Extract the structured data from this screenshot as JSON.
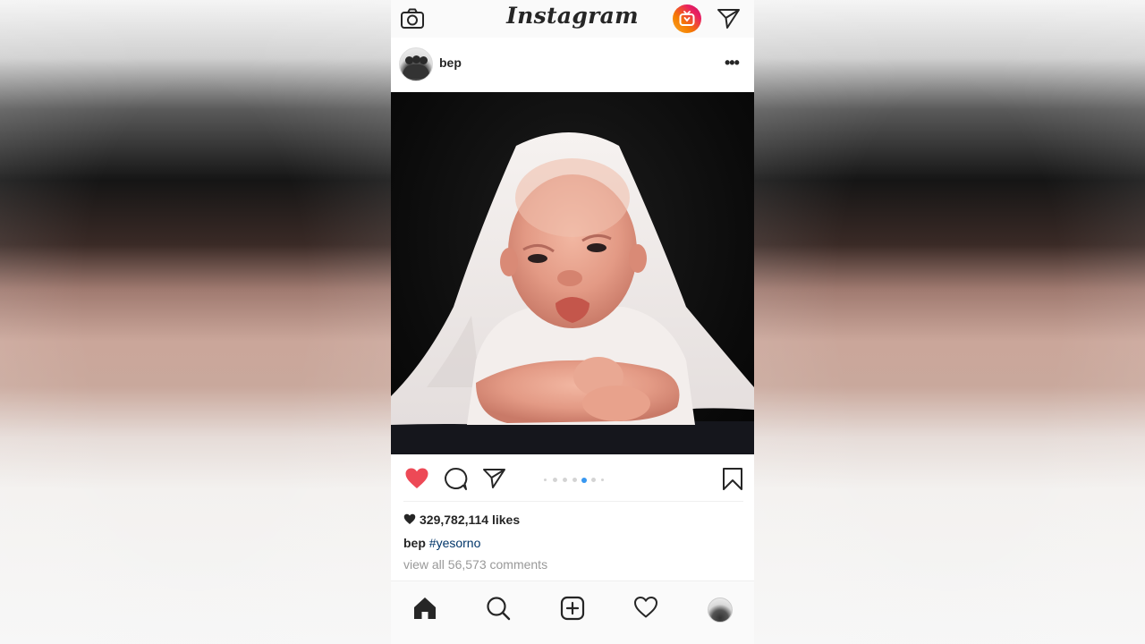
{
  "app": {
    "title": "Instagram",
    "accent_color": "#3897f0",
    "like_color": "#ed4956"
  },
  "topbar": {
    "camera_icon": "camera-icon",
    "igtv_icon": "igtv-icon",
    "direct_icon": "paper-plane-icon"
  },
  "post": {
    "username": "bep",
    "more_label": "•••",
    "image_icon": "baby-photo",
    "liked": true,
    "carousel": {
      "count": 7,
      "active_index": 4
    },
    "likes_text": "329,782,114 likes",
    "caption_user": "bep",
    "caption_tag": "#yesorno",
    "comments_text": "view all 56,573 comments"
  },
  "bottom_nav": {
    "items": [
      "home-icon",
      "search-icon",
      "add-post-icon",
      "activity-heart-icon",
      "profile-avatar"
    ]
  }
}
